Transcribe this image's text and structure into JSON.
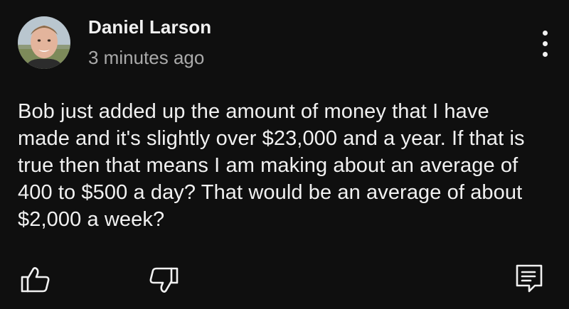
{
  "comment": {
    "author": "Daniel Larson",
    "timestamp": "3 minutes ago",
    "text": "Bob just added up the amount of money that I have made and it's slightly over $23,000 and a year. If that is true then that means I am making about an average of 400 to $500 a day? That would be an average of about $2,000 a week?"
  },
  "icons": {
    "avatar": "avatar-photo",
    "more": "more-vertical-icon",
    "like": "thumbs-up-icon",
    "dislike": "thumbs-down-icon",
    "reply": "reply-icon"
  },
  "colors": {
    "background": "#0f0f0f",
    "primary_text": "#f1f1f1",
    "secondary_text": "#aaaaaa"
  }
}
